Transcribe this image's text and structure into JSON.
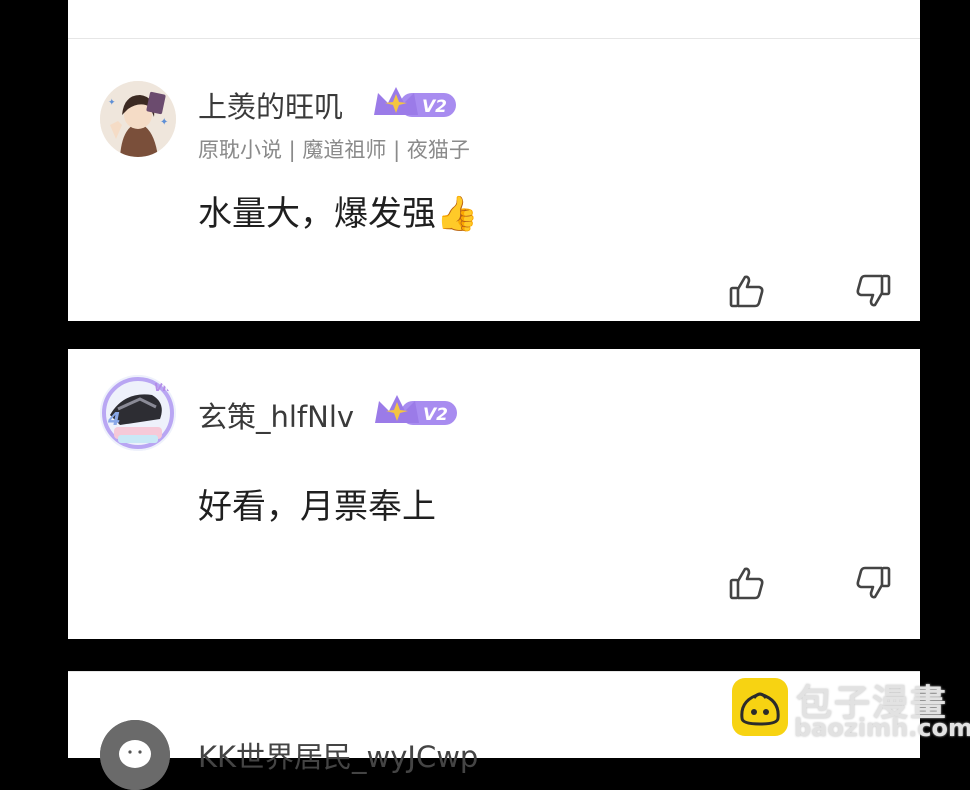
{
  "comments": [
    {
      "username": "上羡的旺叽",
      "level": "V2",
      "tags": "原耽小说 | 魔道祖师 | 夜猫子",
      "text": "水量大，爆发强👍"
    },
    {
      "username": "玄策_hlfNlv",
      "level": "V2",
      "tags": "",
      "text": "好看，月票奉上"
    },
    {
      "username": "KK世界居民_wyJCwp",
      "level": "",
      "tags": "",
      "text": ""
    }
  ],
  "icons": {
    "like": "thumbs-up-icon",
    "dislike": "thumbs-down-icon",
    "badge": "crown-vip-icon"
  },
  "watermark": {
    "name": "包子漫畫",
    "url": "baozimh.com"
  },
  "colors": {
    "badge_purple": "#9b7be8",
    "badge_gold": "#f4c542",
    "logo_yellow": "#f7d312"
  }
}
